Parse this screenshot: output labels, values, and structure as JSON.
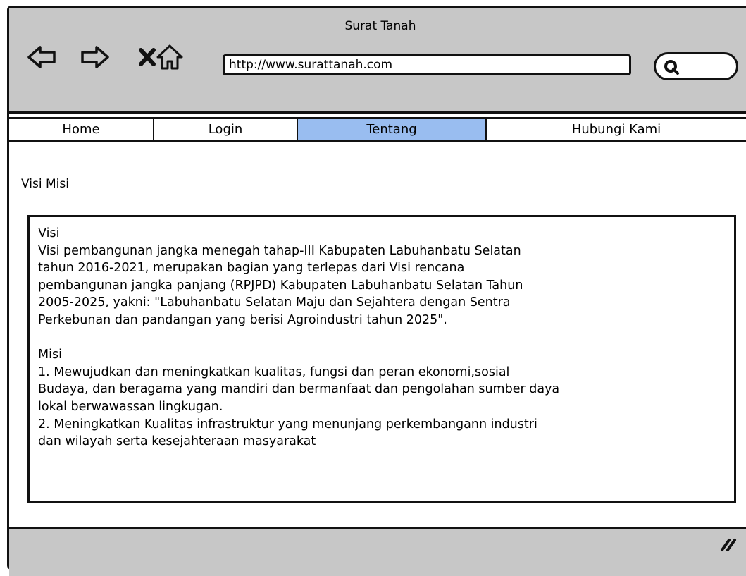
{
  "window": {
    "title": "Surat Tanah"
  },
  "toolbar": {
    "back_icon": "back-arrow-icon",
    "forward_icon": "forward-arrow-icon",
    "stop_icon": "close-icon",
    "home_icon": "home-icon",
    "url": "http://www.surattanah.com",
    "search_icon": "search-icon"
  },
  "menu": {
    "items": [
      {
        "label": "Home",
        "active": false
      },
      {
        "label": "Login",
        "active": false
      },
      {
        "label": "Tentang",
        "active": true
      },
      {
        "label": "Hubungi Kami",
        "active": false
      }
    ],
    "active_color": "#99bdf0"
  },
  "main": {
    "section_title": "Visi Misi",
    "visi_heading": "Visi",
    "visi_text": "Visi pembangunan jangka menegah tahap-III  Kabupaten Labuhanbatu Selatan\ntahun 2016-2021, merupakan bagian yang terlepas dari Visi rencana\npembangunan jangka panjang (RPJPD) Kabupaten Labuhanbatu Selatan Tahun\n2005-2025, yakni: \"Labuhanbatu Selatan Maju dan Sejahtera dengan Sentra\nPerkebunan dan pandangan yang berisi Agroindustri tahun 2025\".",
    "misi_heading": "Misi",
    "misi_1": "1. Mewujudkan dan meningkatkan kualitas, fungsi dan peran ekonomi,sosial\nBudaya, dan beragama yang mandiri dan bermanfaat dan pengolahan sumber daya\nlokal berwawassan lingkugan.",
    "misi_2": "2. Meningkatkan Kualitas infrastruktur yang menunjang perkembangann industri\ndan wilayah serta kesejahteraan masyarakat"
  },
  "colors": {
    "chrome": "#c7c7c7",
    "border": "#111111"
  }
}
